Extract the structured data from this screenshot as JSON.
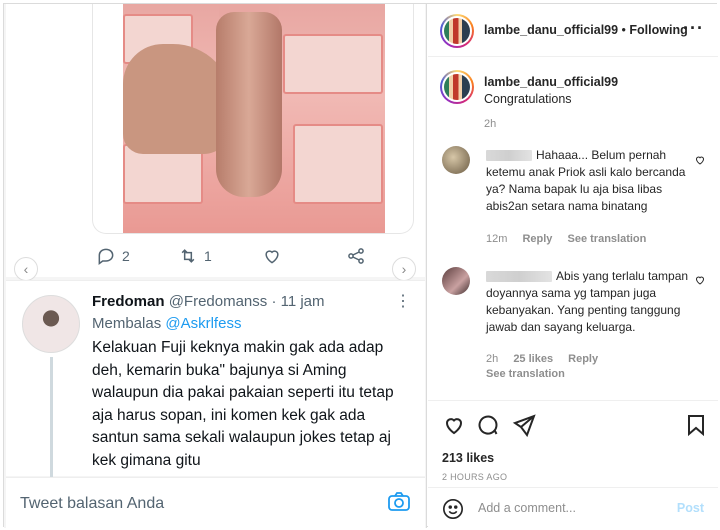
{
  "tweet": {
    "stats": {
      "replies": "2",
      "retweets": "1"
    },
    "author_name": "Fredoman",
    "author_handle": "@Fredomanss",
    "time": "· 11 jam",
    "more": "⋮",
    "reply_prefix": "Membalas",
    "reply_to": "@Askrlfess",
    "text": "Kelakuan Fuji keknya makin gak ada adap deh, kemarin buka\" bajunya si Aming walaupun dia pakai pakaian seperti itu tetap aja harus sopan, ini komen kek gak ada santun sama sekali walaupun jokes tetap aj kek gimana gitu",
    "compose_placeholder": "Tweet balasan Anda",
    "nav_prev": "‹",
    "nav_next": "›"
  },
  "instagram": {
    "header": {
      "username": "lambe_danu_official99",
      "separator": " • ",
      "follow_label": "Following",
      "more": "···"
    },
    "caption": {
      "username": "lambe_danu_official99",
      "text": "Congratulations",
      "time": "2h"
    },
    "comments": [
      {
        "text": "Hahaaa... Belum pernah ketemu anak Priok asli kalo bercanda ya? Nama bapak lu aja bisa libas abis2an setara nama binatang",
        "time": "12m",
        "reply_label": "Reply",
        "translate_label": "See translation"
      },
      {
        "text": "Abis yang terlalu tampan doyannya sama yg tampan juga kebanyakan. Yang penting tanggung jawab dan sayang keluarga.",
        "time": "2h",
        "likes": "25 likes",
        "reply_label": "Reply",
        "translate_label": "See translation"
      }
    ],
    "likes": "213 likes",
    "posted_ago": "2 HOURS AGO",
    "add_comment_placeholder": "Add a comment...",
    "post_label": "Post"
  }
}
